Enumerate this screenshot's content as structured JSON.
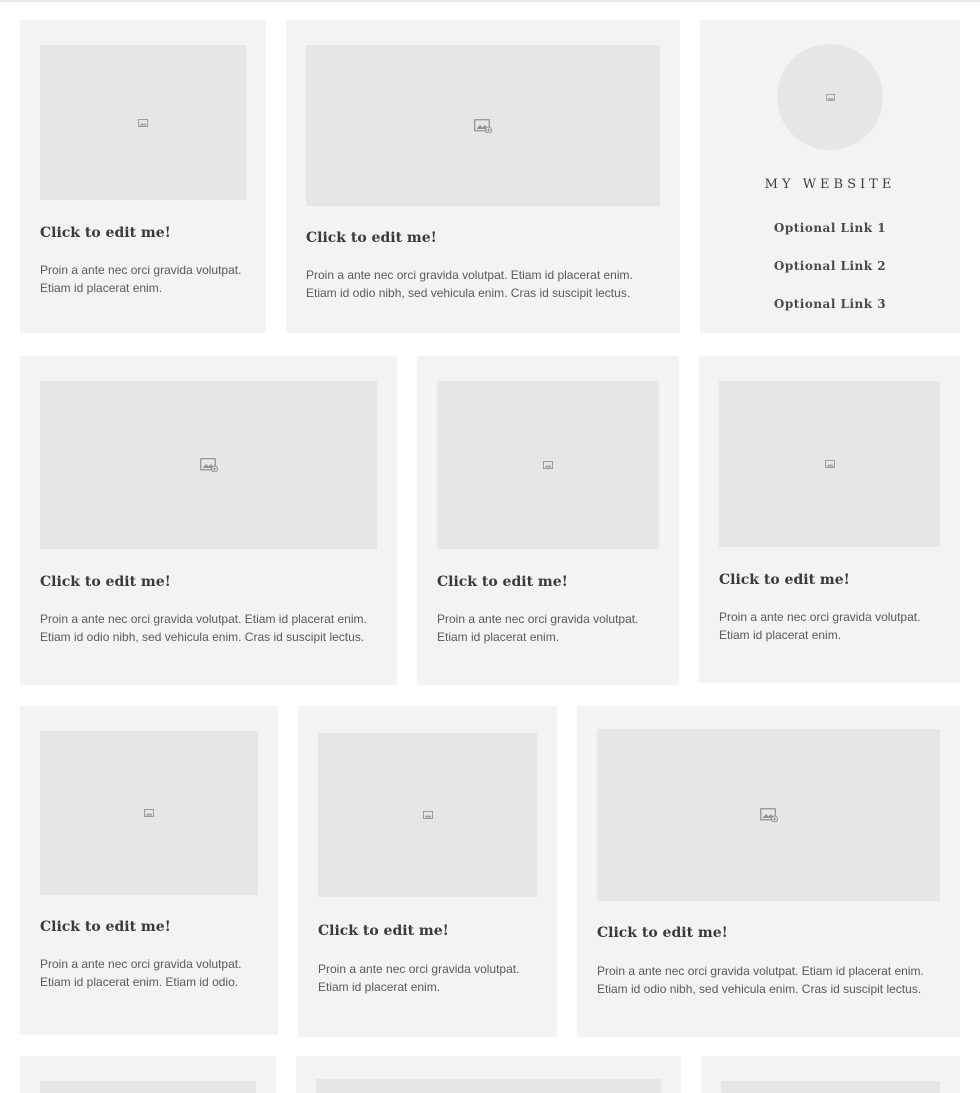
{
  "site": {
    "title": "MY WEBSITE",
    "links": [
      "Optional Link 1",
      "Optional Link 2",
      "Optional Link 3"
    ]
  },
  "cards": [
    {
      "title": "Click to edit me!",
      "lines": [
        "Proin a ante nec orci gravida volutpat.",
        "Etiam id placerat enim."
      ]
    },
    {
      "title": "Click to edit me!",
      "lines": [
        "Proin a ante nec orci gravida volutpat. Etiam id placerat enim.",
        "Etiam id odio nibh, sed vehicula enim. Cras id suscipit lectus."
      ]
    },
    {
      "title": "Click to edit me!",
      "lines": [
        "Proin a ante nec orci gravida volutpat. Etiam id placerat enim.",
        "Etiam id odio nibh, sed vehicula enim. Cras id suscipit lectus."
      ]
    },
    {
      "title": "Click to edit me!",
      "lines": [
        "Proin a ante nec orci gravida volutpat.",
        "Etiam id placerat enim."
      ]
    },
    {
      "title": "Click to edit me!",
      "lines": [
        "Proin a ante nec orci gravida volutpat.",
        "Etiam id placerat enim."
      ]
    },
    {
      "title": "Click to edit me!",
      "lines": [
        "Proin a ante nec orci gravida volutpat.",
        "Etiam id placerat enim. Etiam id odio."
      ]
    },
    {
      "title": "Click to edit me!",
      "lines": [
        "Proin a ante nec orci gravida volutpat.",
        "Etiam id placerat enim."
      ]
    },
    {
      "title": "Click to edit me!",
      "lines": [
        "Proin a ante nec orci gravida volutpat. Etiam id placerat enim.",
        "Etiam id odio nibh, sed vehicula enim. Cras id suscipit lectus."
      ]
    }
  ],
  "colors": {
    "card_bg": "#f3f3f3",
    "image_placeholder": "#e6e6e6",
    "title_text": "#3a3a3a",
    "body_text": "#5a5a5a"
  },
  "icons": {
    "image_placeholder": "image-icon"
  }
}
